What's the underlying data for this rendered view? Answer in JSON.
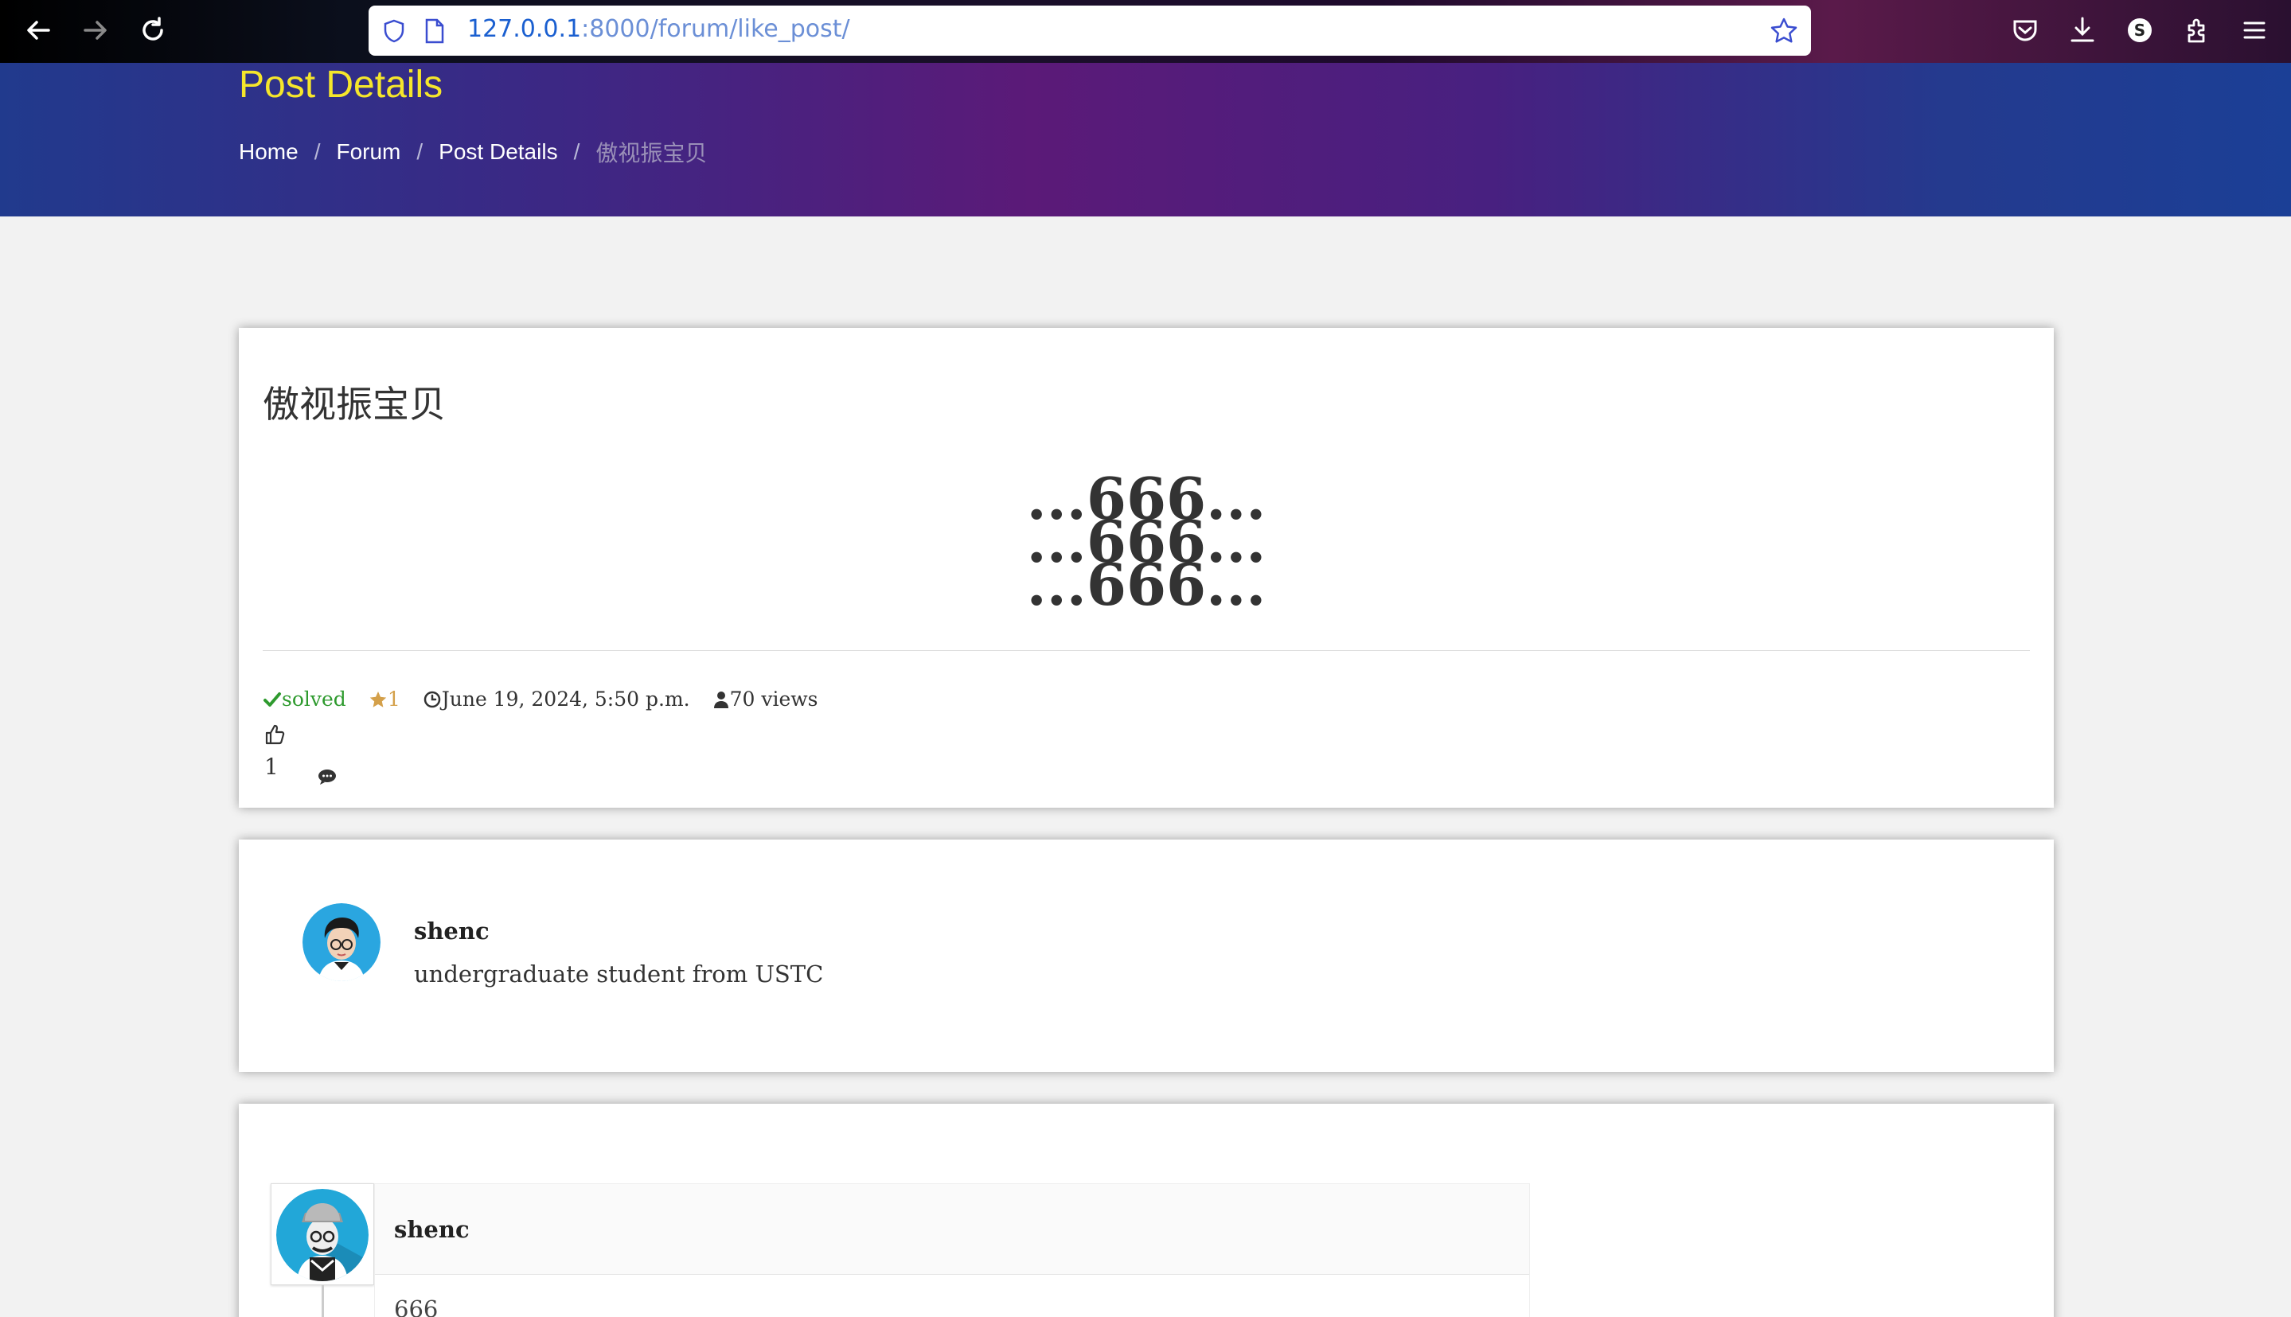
{
  "browser": {
    "url_host": "127.0.0.1",
    "url_rest": ":8000/forum/like_post/",
    "profile_letter": "S"
  },
  "header": {
    "title": "Post Details",
    "breadcrumb": [
      "Home",
      "Forum",
      "Post Details",
      "傲视振宝贝"
    ]
  },
  "post": {
    "title": "傲视振宝贝",
    "body_lines": [
      "...666...",
      "...666...",
      "...666..."
    ],
    "status": "solved",
    "stars": "1",
    "date": "June 19, 2024, 5:50 p.m.",
    "views": "70 views",
    "likes": "1"
  },
  "author": {
    "name": "shenc",
    "bio": "undergraduate student from USTC"
  },
  "comments": [
    {
      "name": "shenc",
      "text": "666"
    }
  ],
  "colors": {
    "hero_title": "#f5e62b",
    "solved": "#2e9a2e",
    "star": "#d4a04a",
    "link": "#1a5fd0"
  }
}
